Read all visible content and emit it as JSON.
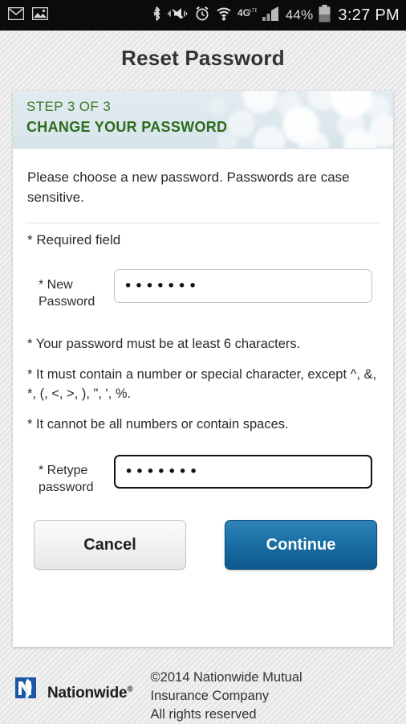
{
  "status_bar": {
    "left_icons": [
      "gmail-icon",
      "photo-icon"
    ],
    "right_icons": [
      "bluetooth-icon",
      "vibrate-mute-icon",
      "alarm-clock-icon",
      "wifi-icon",
      "4g-lte-icon",
      "signal-bars-icon",
      "battery-icon"
    ],
    "network_label": "4G",
    "network_sub_label": "LTE",
    "battery_percent": "44%",
    "time": "3:27 PM"
  },
  "header": {
    "title": "Reset Password"
  },
  "step_header": {
    "step_label": "STEP 3 OF 3",
    "step_title": "CHANGE YOUR PASSWORD",
    "text_color": "#3d7a2a",
    "title_color": "#2c6b1c",
    "background_color": "#dce8ee"
  },
  "form": {
    "intro": "Please choose a new password. Passwords are case sensitive.",
    "required_note": "* Required field",
    "fields": [
      {
        "label": "* New Password",
        "label_line1": "* New",
        "label_line2": "Password",
        "value": "•••••••",
        "masked_length": 7,
        "focused": false
      },
      {
        "label": "* Retype password",
        "label_line1": "* Retype",
        "label_line2": "password",
        "value": "•••••••",
        "masked_length": 7,
        "focused": true
      }
    ],
    "rules": [
      "* Your password must be at least 6 characters.",
      "* It must contain a number or special character, except ^, &, *, (, <, >, ), \", ', %.",
      "* It cannot be all numbers or contain spaces."
    ]
  },
  "buttons": {
    "cancel_label": "Cancel",
    "continue_label": "Continue",
    "continue_color": "#1a6fa5"
  },
  "footer": {
    "logo_name": "Nationwide",
    "logo_registered": "®",
    "copyright_line1": "©2014 Nationwide Mutual",
    "copyright_line2": "Insurance Company",
    "copyright_line3": "All rights reserved",
    "logo_color": "#1b55a5"
  }
}
